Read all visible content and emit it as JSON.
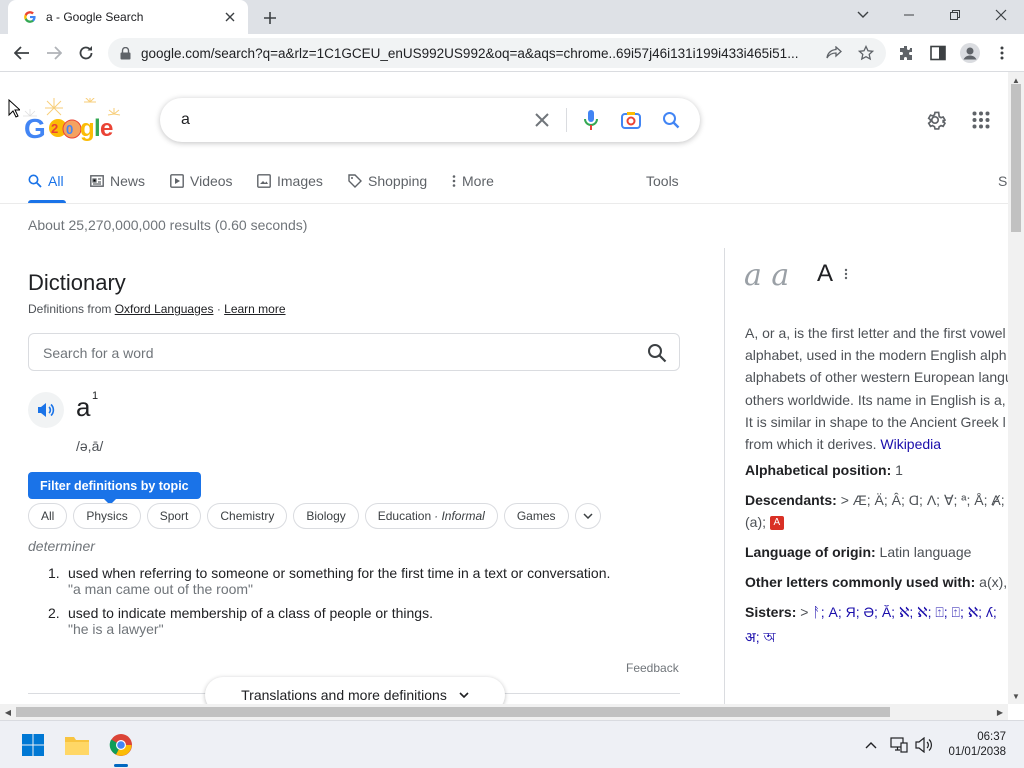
{
  "browser": {
    "tab_title": "a - Google Search",
    "url": "google.com/search?q=a&rlz=1C1GCEU_enUS992US992&oq=a&aqs=chrome..69i57j46i131i199i433i465i51..."
  },
  "search": {
    "query": "a"
  },
  "nav": {
    "items": [
      "All",
      "News",
      "Videos",
      "Images",
      "Shopping",
      "More"
    ],
    "tools": "Tools",
    "cut_label": "S"
  },
  "stats": "About 25,270,000,000 results (0.60 seconds)",
  "dictionary": {
    "title": "Dictionary",
    "source_prefix": "Definitions from",
    "source_link": "Oxford Languages",
    "sep": "·",
    "learn_more": "Learn more",
    "search_placeholder": "Search for a word",
    "headword": "a",
    "superscript": "1",
    "phonetic": "/ə,ā/",
    "filter_tip": "Filter definitions by topic",
    "chips": [
      "All",
      "Physics",
      "Sport",
      "Chemistry",
      "Biology",
      "Education",
      "Games"
    ],
    "chip_informal": "· Informal",
    "part_of_speech": "determiner",
    "definitions": [
      {
        "num": "1.",
        "text": "used when referring to someone or something for the first time in a text or conversation.",
        "example": "\"a man came out of the room\""
      },
      {
        "num": "2.",
        "text": "used to indicate membership of a class of people or things.",
        "example": "\"he is a lawyer\""
      }
    ],
    "feedback": "Feedback",
    "translations": "Translations and more definitions"
  },
  "knowledge_panel": {
    "glyphs": "a a",
    "title": "A",
    "description_lines": [
      "A, or a, is the first letter and the first vowel",
      "alphabet, used in the modern English alph",
      "alphabets of other western European langu",
      "others worldwide. Its name in English is a,",
      "It is similar in shape to the Ancient Greek l"
    ],
    "description_last": "from which it derives.",
    "wikipedia": "Wikipedia",
    "position_label": "Alphabetical position:",
    "position_value": "1",
    "descendants_label": "Descendants:",
    "descendants_value": "> Æ; Ä; Â; Ɑ; Λ; ∀; ª; Å; Ⱥ; @",
    "descendants_line2": "(a);",
    "descendants_badge": "A",
    "origin_label": "Language of origin:",
    "origin_value": "Latin language",
    "other_label": "Other letters commonly used with:",
    "other_value": "a(x), ae",
    "sisters_label": "Sisters:",
    "sisters_prefix": ">",
    "sisters_value": "ᚨ; A; Я; Ə; Ă; ℵ; ℵ; ⍐; ⍐; ℵ; ʎ;",
    "sisters_line2": "अ; অ"
  },
  "taskbar": {
    "time": "06:37",
    "date": "01/01/2038"
  },
  "colors": {
    "accent": "#1a73e8",
    "link": "#1a0dab",
    "badge": "#d93025"
  }
}
